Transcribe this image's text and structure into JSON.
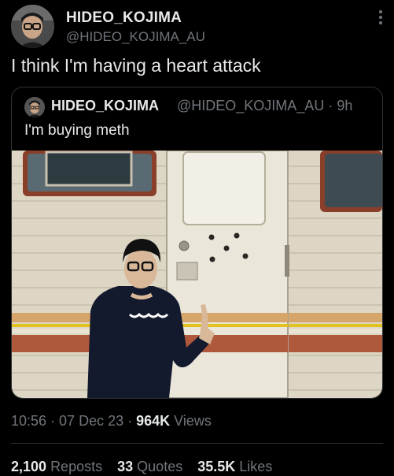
{
  "author": {
    "name": "HIDEO_KOJIMA",
    "handle": "@HIDEO_KOJIMA_AU"
  },
  "tweet": {
    "text": "I think I'm having a heart attack"
  },
  "quoted": {
    "name": "HIDEO_KOJIMA",
    "handle": "@HIDEO_KOJIMA_AU",
    "separator": "·",
    "time": "9h",
    "text": "I'm buying meth"
  },
  "meta": {
    "time": "10:56",
    "date": "07 Dec 23",
    "views_count": "964K",
    "views_label": "Views"
  },
  "stats": {
    "reposts_count": "2,100",
    "reposts_label": "Reposts",
    "quotes_count": "33",
    "quotes_label": "Quotes",
    "likes_count": "35.5K",
    "likes_label": "Likes"
  },
  "colors": {
    "background": "#000000",
    "text_primary": "#e7e9ea",
    "text_secondary": "#71767b",
    "border": "#2f3336"
  },
  "icons": {
    "more": "more-vertical-icon"
  }
}
